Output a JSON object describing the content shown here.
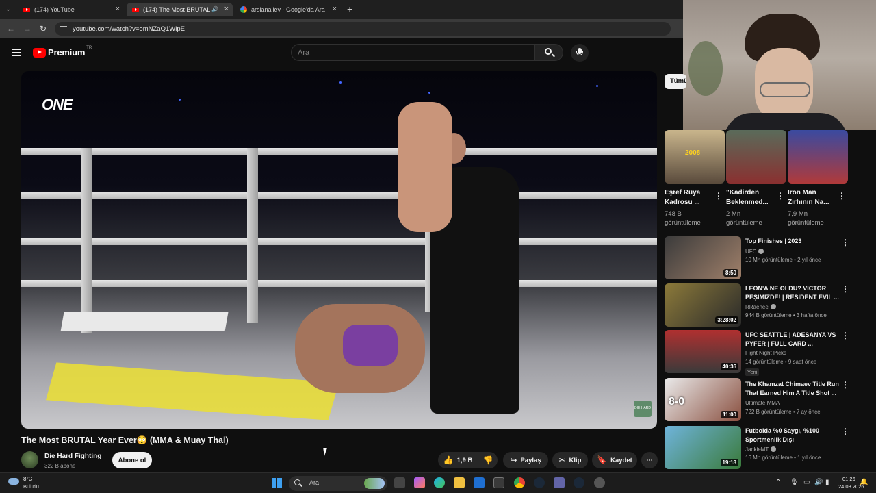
{
  "browser": {
    "tabs": [
      {
        "label": "(174) YouTube"
      },
      {
        "label": "(174) The Most BRUTAL Yea"
      },
      {
        "label": "arslanaliev - Google'da Ara"
      }
    ],
    "new_tab": "+",
    "url": "youtube.com/watch?v=omNZaQ1WipE"
  },
  "header": {
    "logo_text": "Premium",
    "country_code": "TR",
    "search_placeholder": "Ara"
  },
  "video": {
    "logo": "ONE",
    "badge": "DIE HARD",
    "title": "The Most BRUTAL Year Ever😳 (MMA & Muay Thai)"
  },
  "channel": {
    "name": "Die Hard Fighting",
    "subs": "322 B abone",
    "subscribe_label": "Abone ol"
  },
  "actions": {
    "like_count": "1,9 B",
    "share": "Paylaş",
    "clip": "Klip",
    "save": "Kaydet",
    "more": "⋯"
  },
  "sidebar": {
    "chip": "Tümü",
    "shorts": [
      {
        "title": "Eşref Rüya Kadrosu ...",
        "views": "748 B",
        "views2": "görüntüleme"
      },
      {
        "title": "\"Kadirden Beklenmed...",
        "views": "2 Mn",
        "views2": "görüntüleme"
      },
      {
        "title": "Iron Man Zırhının Na...",
        "views": "7,9 Mn",
        "views2": "görüntüleme"
      }
    ],
    "recommended": [
      {
        "title": "Top Finishes | 2023",
        "channel": "UFC",
        "meta": "10 Mn görüntüleme • 2 yıl önce",
        "duration": "8:50"
      },
      {
        "title": "LEON'A NE OLDU? VICTOR PEŞIMIZDE! | RESIDENT EVIL ...",
        "channel": "RRaenee",
        "meta": "944 B görüntüleme • 3 hafta önce",
        "duration": "3:28:02"
      },
      {
        "title": "UFC SEATTLE | ADESANYA VS PYFER | FULL CARD ...",
        "channel": "Fight Night Picks",
        "meta": "14 görüntüleme • 9 saat önce",
        "duration": "40:36",
        "badge": "Yeni"
      },
      {
        "title": "The Khamzat Chimaev Title Run That Earned Him A Title Shot ...",
        "channel": "Ultimate MMA",
        "meta": "722 B görüntüleme • 7 ay önce",
        "duration": "11:00"
      },
      {
        "title": "Futbolda %0 Saygı, %100 Sportmenlik Dışı",
        "channel": "JackieMT",
        "meta": "16 Mn görüntüleme • 1 yıl önce",
        "duration": "19:18"
      }
    ]
  },
  "taskbar": {
    "temp": "8°C",
    "weather": "Bulutlu",
    "search": "Ara",
    "time": "01:26",
    "date": "24.03.2026"
  }
}
